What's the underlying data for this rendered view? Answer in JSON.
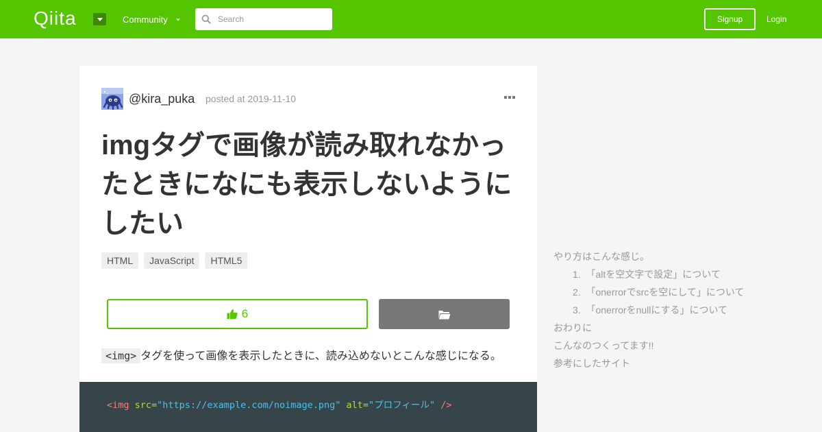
{
  "header": {
    "logo": "Qiita",
    "community_label": "Community",
    "search_placeholder": "Search",
    "signup_label": "Signup",
    "login_label": "Login"
  },
  "article": {
    "username": "@kira_puka",
    "posted": "posted at 2019-11-10",
    "title": "imgタグで画像が読み取れなかったときになにも表示しないようにしたい",
    "tags": [
      "HTML",
      "JavaScript",
      "HTML5"
    ],
    "likes_count": "6",
    "body_code": "<img>",
    "body_text": "タグを使って画像を表示したときに、読み込めないとこんな感じになる。",
    "code": {
      "open": "<img",
      "src_attr": "src=",
      "src_value": "\"https://example.com/noimage.png\"",
      "alt_attr": "alt=",
      "alt_value": "\"プロフィール\"",
      "close": "/>"
    }
  },
  "toc": {
    "items": [
      {
        "label": "やり方はこんな感じ。"
      },
      {
        "label": "1.  「altを空文字で設定」について"
      },
      {
        "label": "2.  「onerrorでsrcを空にして」について"
      },
      {
        "label": "3.  「onerrorをnullにする」について"
      },
      {
        "label": "おわりに"
      },
      {
        "label": "こんなのつくってます!!"
      },
      {
        "label": "参考にしたサイト"
      }
    ]
  },
  "colors": {
    "brand": "#55c500",
    "code_bg": "#364549"
  }
}
